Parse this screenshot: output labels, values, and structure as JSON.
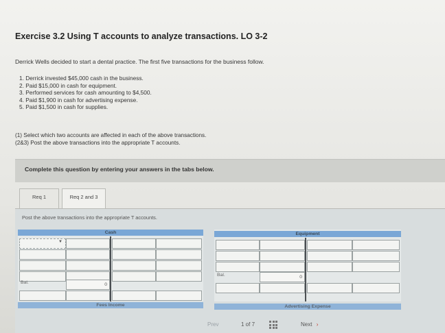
{
  "exercise": {
    "title": "Exercise 3.2 Using T accounts to analyze transactions. LO 3-2",
    "intro": "Derrick Wells decided to start a dental practice. The first five transactions for the business follow.",
    "transactions": [
      "1. Derrick invested $45,000 cash in the business.",
      "2. Paid $15,000 in cash for equipment.",
      "3. Performed services for cash amounting to $4,500.",
      "4. Paid $1,900 in cash for advertising expense.",
      "5. Paid $1,500 in cash for supplies."
    ],
    "instructions": [
      "(1) Select which two accounts are affected in each of the above transactions.",
      "(2&3) Post the above transactions into the appropriate T accounts."
    ]
  },
  "banner": {
    "text": "Complete this question by entering your answers in the tabs below."
  },
  "tabs": [
    {
      "label": "Req 1"
    },
    {
      "label": "Req 2 and 3"
    }
  ],
  "panel": {
    "instruction": "Post the above transactions into the appropriate T accounts."
  },
  "t_accounts": [
    {
      "name": "Cash",
      "bal_label": "Bal.",
      "bal_value": "0"
    },
    {
      "name": "Equipment",
      "bal_label": "Bal.",
      "bal_value": "0"
    },
    {
      "name": "Fees Income"
    },
    {
      "name": "Advertising Expense"
    }
  ],
  "pagination": {
    "prev": "Prev",
    "page": "1 of 7",
    "next": "Next"
  },
  "colors": {
    "header_blue": "#7aa7d6",
    "panel_bg": "#d8ddde",
    "banner_bg": "#cfd0cc"
  },
  "icons": {
    "dropdown": "chevron-down-icon",
    "grid": "grid-icon",
    "next": "chevron-right-icon"
  }
}
